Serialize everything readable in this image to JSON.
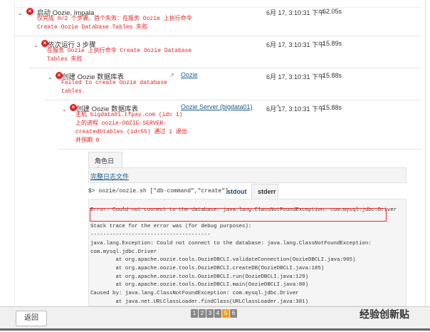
{
  "steps": [
    {
      "title": "启动 Oozie, Impala",
      "msg": [
        "仅完成 0/2 个步骤。首个失败：在服务 Oozie 上执行命令",
        "Create Oozie Database Tables 失败"
      ],
      "date": "6月 17, 3:10:31 下午",
      "duration": "62.05s"
    },
    {
      "title": "依次运行 3 步骤",
      "msg": [
        "在服务 Oozie 上执行命令 Create Oozie Database",
        "Tables 失败"
      ],
      "date": "6月 17, 3:10:31 下午",
      "duration": "15.89s"
    },
    {
      "title": "创建 Oozie 数据库表",
      "msg": [
        "Failed to create Oozie database",
        "tables."
      ],
      "link": "Oozie",
      "date": "6月 17, 3:10:31 下午",
      "duration": "15.88s"
    },
    {
      "title": "创建 Oozie 数据库表",
      "msg": [
        "主机 bigdata01.tfpay.com (id= 1)",
        "上的进程 oozie-OOZIE-SERVER-",
        "createdbtables (id=55) 通过 1 退出",
        "并预期 0"
      ],
      "link": "Oozie Server (bigdata01)",
      "date": "6月 17, 3:10:31 下午",
      "duration": "15.88s"
    }
  ],
  "log": {
    "tab": "角色日志",
    "full_log_link": "完整日志文件",
    "command": "$> oozie/oozie.sh [\"db-command\",\"create\"]",
    "stdout": "stdout",
    "stderr": "stderr",
    "output": "Error: Could not connect to the database: java.lang.ClassNotFoundException: com.mysql.jdbc.Driver\n\nStack trace for the error was (for debug purposes):\n--------------------------------------\njava.lang.Exception: Could not connect to the database: java.lang.ClassNotFoundException:\ncom.mysql.jdbc.Driver\n        at org.apache.oozie.tools.OozieDBCLI.validateConnection(OozieDBCLI.java:905)\n        at org.apache.oozie.tools.OozieDBCLI.createDB(OozieDBCLI.java:185)\n        at org.apache.oozie.tools.OozieDBCLI.run(OozieDBCLI.java:129)\n        at org.apache.oozie.tools.OozieDBCLI.main(OozieDBCLI.java:80)\nCaused by: java.lang.ClassNotFoundException: com.mysql.jdbc.Driver\n        at java.net.URLClassLoader.findClass(URLClassLoader.java:381)"
  },
  "footer": {
    "back": "返回",
    "pages": [
      "1",
      "2",
      "3",
      "4",
      "5",
      "6"
    ],
    "active_page": "5",
    "watermark": "经验创新贴"
  },
  "colors": {
    "error": "#e02020",
    "link": "#1a5a8a",
    "active_page": "#f0a020"
  }
}
